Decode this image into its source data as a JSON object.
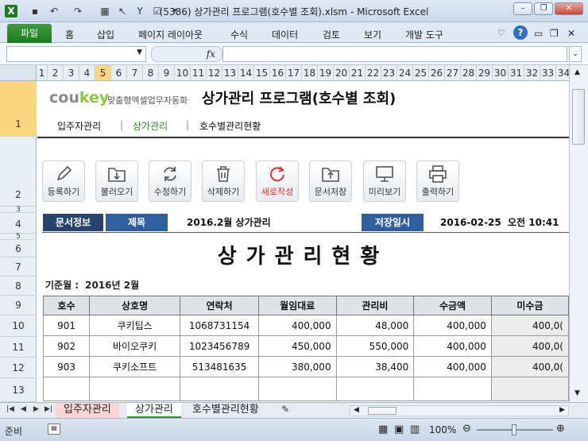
{
  "window": {
    "title": "(5386) 상가관리 프로그램(호수별 조회).xlsm  -  Microsoft Excel"
  },
  "ribbon": {
    "file": "파일",
    "tabs": [
      "홈",
      "삽입",
      "페이지 레이아웃",
      "수식",
      "데이터",
      "검토",
      "보기",
      "개발 도구"
    ]
  },
  "formula_bar": {
    "fx": "fx"
  },
  "columns": [
    "1",
    "2",
    "3",
    "4",
    "5",
    "6",
    "7",
    "8",
    "9",
    "10",
    "11",
    "12",
    "13",
    "14",
    "15",
    "16",
    "17",
    "18",
    "19",
    "20",
    "21",
    "22",
    "23",
    "24",
    "25",
    "26",
    "27",
    "28",
    "29",
    "30",
    "31",
    "32",
    "33",
    "34"
  ],
  "selected_column": "5",
  "rows": [
    "1",
    "2",
    "3",
    "4",
    "5",
    "6",
    "7",
    "8",
    "9",
    "10",
    "11",
    "12",
    "13"
  ],
  "app": {
    "logo_main": "cou",
    "logo_key": "key",
    "slogan": "맞춤형엑셀업무자동화",
    "title": "상가관리 프로그램(호수별 조회)",
    "nav": [
      "입주자관리",
      "상가관리",
      "호수별관리현황"
    ],
    "nav_sep": "|"
  },
  "toolbar": [
    {
      "label": "등록하기",
      "icon": "pencil-icon"
    },
    {
      "label": "불러오기",
      "icon": "folder-open-icon"
    },
    {
      "label": "수정하기",
      "icon": "refresh-icon"
    },
    {
      "label": "삭제하기",
      "icon": "trash-icon"
    },
    {
      "label": "새로작성",
      "icon": "new-doc-icon"
    },
    {
      "label": "문서저장",
      "icon": "save-folder-icon"
    },
    {
      "label": "미리보기",
      "icon": "monitor-icon"
    },
    {
      "label": "출력하기",
      "icon": "printer-icon"
    }
  ],
  "info": {
    "doc_label": "문서정보",
    "subject_label": "제목",
    "subject": "2016.2월 상가관리",
    "saved_label": "저장일시",
    "saved_date": "2016-02-25",
    "saved_time": "오전 10:41"
  },
  "report": {
    "title": "상가관리현황",
    "base_label": "기준월 :",
    "base_value": "2016년 2월",
    "headers": [
      "호수",
      "상호명",
      "연락처",
      "월임대료",
      "관리비",
      "수금액",
      "미수금"
    ],
    "rows": [
      [
        "901",
        "쿠키팁스",
        "1068731154",
        "400,000",
        "48,000",
        "400,000",
        "400,0("
      ],
      [
        "902",
        "바이오쿠키",
        "1023456789",
        "450,000",
        "550,000",
        "400,000",
        "400,0("
      ],
      [
        "903",
        "쿠키소프트",
        "513481635",
        "380,000",
        "38,400",
        "400,000",
        "400,0("
      ],
      [
        "",
        "",
        "",
        "",
        "",
        "",
        ""
      ]
    ]
  },
  "sheets": [
    "입주자관리",
    "상가관리",
    "호수별관리현황"
  ],
  "status": {
    "ready": "준비",
    "zoom": "100%"
  }
}
